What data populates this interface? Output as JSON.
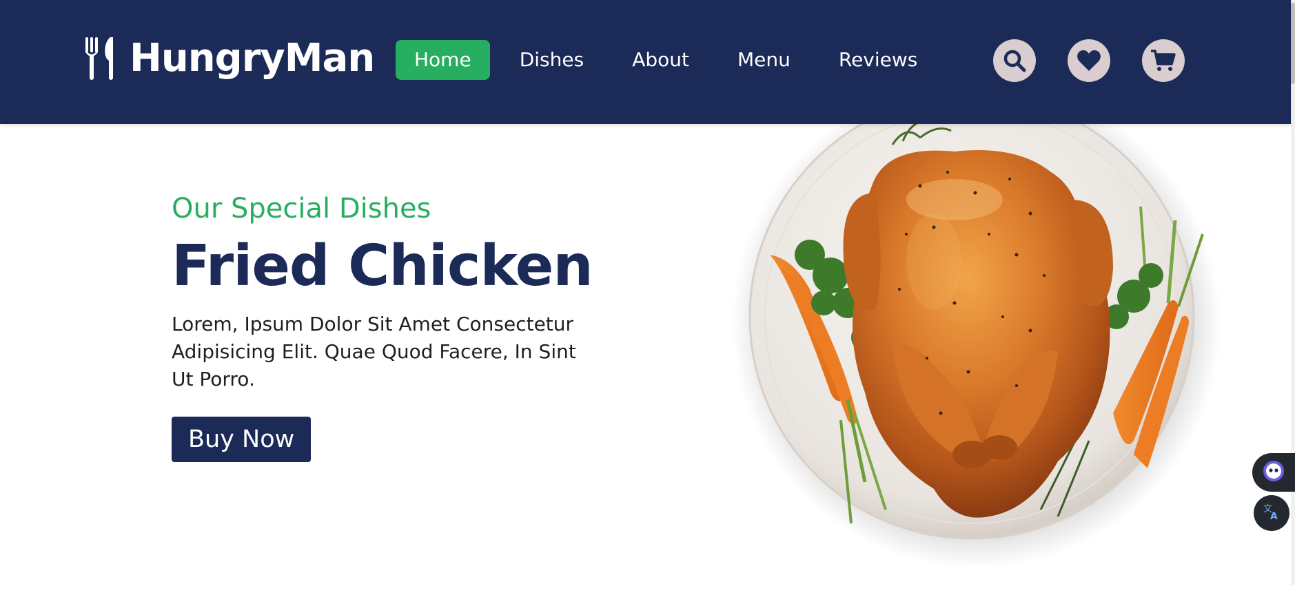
{
  "brand": {
    "name": "HungryMan",
    "logo_icon": "utensils-icon"
  },
  "nav": {
    "items": [
      {
        "label": "Home",
        "active": true
      },
      {
        "label": "Dishes",
        "active": false
      },
      {
        "label": "About",
        "active": false
      },
      {
        "label": "Menu",
        "active": false
      },
      {
        "label": "Reviews",
        "active": false
      }
    ]
  },
  "header_icons": [
    "search-icon",
    "heart-icon",
    "cart-icon"
  ],
  "hero": {
    "subtitle": "Our Special Dishes",
    "title": "Fried Chicken",
    "description": "Lorem, Ipsum Dolor Sit Amet Consectetur Adipisicing Elit. Quae Quod Facere, In Sint Ut Porro.",
    "button_label": "Buy Now",
    "image": "roast-chicken-plate"
  },
  "floating_widgets": [
    "assistant-icon",
    "translate-icon"
  ],
  "colors": {
    "header_bg": "#1b2a57",
    "accent_green": "#27ae60",
    "title_navy": "#1b2a57",
    "icon_circle_bg": "#d9cdd0"
  }
}
